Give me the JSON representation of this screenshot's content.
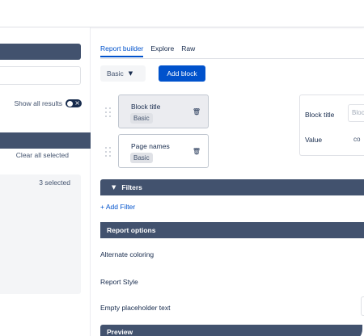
{
  "left_panel": {
    "show_all_results": "Show all results",
    "clear_all_selected": "Clear all selected",
    "selected_count": "3 selected"
  },
  "tabs": [
    {
      "label": "Report builder",
      "active": true
    },
    {
      "label": "Explore",
      "active": false
    },
    {
      "label": "Raw",
      "active": false
    }
  ],
  "toolbar": {
    "block_type": "Basic",
    "add_block": "Add block"
  },
  "blocks": [
    {
      "title": "Block title",
      "badge": "Basic",
      "selected": true
    },
    {
      "title": "Page names",
      "badge": "Basic",
      "selected": false
    }
  ],
  "properties": {
    "block_title_label": "Block title",
    "block_title_placeholder": "Block title",
    "value_label": "Value",
    "value_text": "co"
  },
  "filters": {
    "header": "Filters",
    "add_filter": "+ Add Filter"
  },
  "report_options": {
    "header": "Report options",
    "alternate_coloring": "Alternate coloring",
    "report_style": "Report Style",
    "empty_placeholder": "Empty placeholder text"
  },
  "preview": {
    "header": "Preview"
  },
  "colors": {
    "accent": "#0052cc",
    "header_bg": "#42526e",
    "text": "#172b4d"
  }
}
